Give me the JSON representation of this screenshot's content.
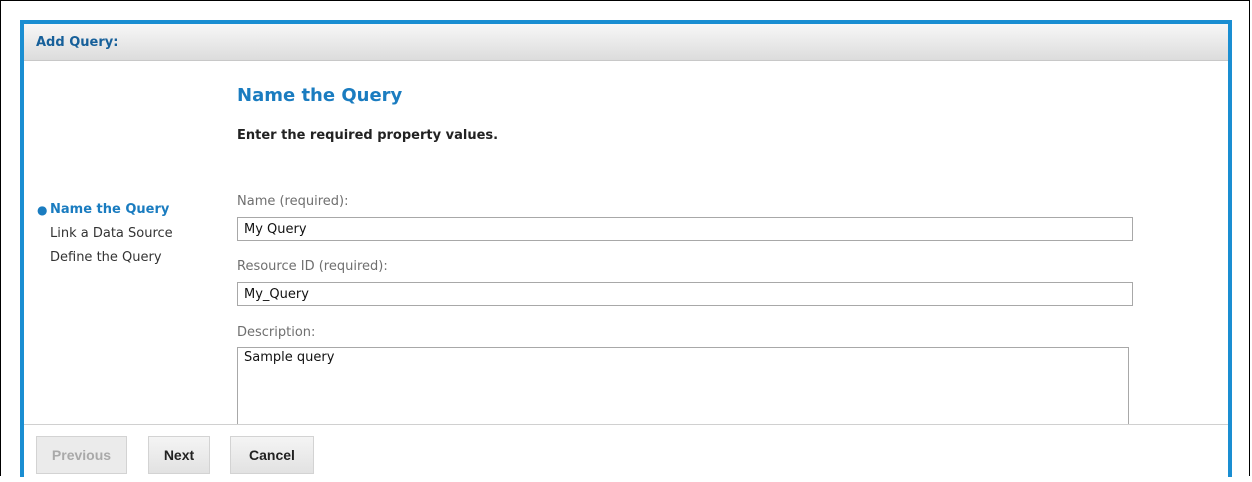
{
  "dialog": {
    "title": "Add Query:"
  },
  "steps": [
    {
      "label": "Name the Query",
      "active": true
    },
    {
      "label": "Link a Data Source",
      "active": false
    },
    {
      "label": "Define the Query",
      "active": false
    }
  ],
  "section": {
    "title": "Name the Query",
    "instructions": "Enter the required property values."
  },
  "fields": {
    "name": {
      "label": "Name (required):",
      "value": "My Query"
    },
    "resource_id": {
      "label": "Resource ID (required):",
      "value": "My_Query"
    },
    "description": {
      "label": "Description:",
      "value": "Sample query"
    }
  },
  "buttons": {
    "previous": "Previous",
    "next": "Next",
    "cancel": "Cancel"
  },
  "colors": {
    "accent": "#1a8ed2",
    "title_blue": "#1a7cc0"
  }
}
